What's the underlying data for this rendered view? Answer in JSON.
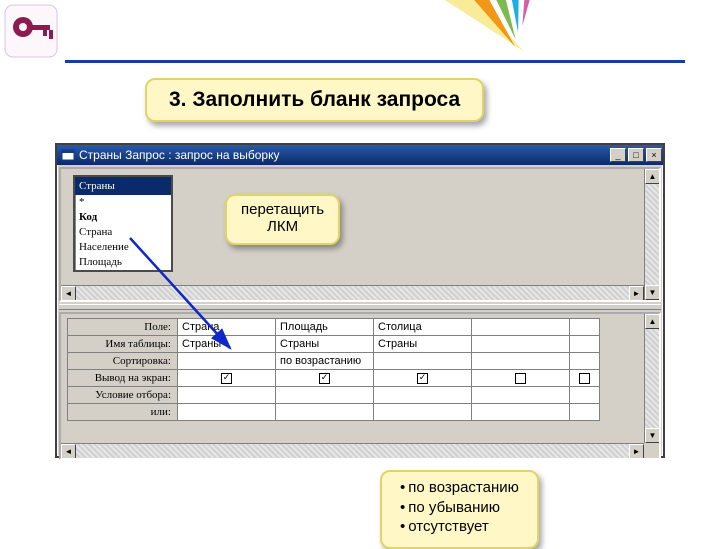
{
  "callouts": {
    "title": "3. Заполнить бланк запроса",
    "drag_line1": "перетащить",
    "drag_line2": "ЛКМ",
    "sort_opt1": "по возрастанию",
    "sort_opt2": "по убыванию",
    "sort_opt3": "отсутствует"
  },
  "window": {
    "title": "Страны Запрос : запрос на выборку",
    "min_glyph": "_",
    "max_glyph": "□",
    "close_glyph": "×",
    "field_list": {
      "table_name": "Страны",
      "items": {
        "star": "*",
        "kod": "Код",
        "strana": "Страна",
        "naselenie": "Население",
        "ploshchad": "Площадь"
      }
    },
    "scroll": {
      "left": "◄",
      "right": "►",
      "up": "▲",
      "down": "▼"
    }
  },
  "grid": {
    "row_labels": {
      "field": "Поле:",
      "table": "Имя таблицы:",
      "sort": "Сортировка:",
      "show": "Вывод на экран:",
      "criteria": "Условие отбора:",
      "or": "или:"
    },
    "cols": [
      {
        "field": "Страна",
        "table": "Страны",
        "sort": "",
        "show": true
      },
      {
        "field": "Площадь",
        "table": "Страны",
        "sort": "по возрастанию",
        "show": true
      },
      {
        "field": "Столица",
        "table": "Страны",
        "sort": "",
        "show": true
      },
      {
        "field": "",
        "table": "",
        "sort": "",
        "show": false
      },
      {
        "field": "",
        "table": "",
        "sort": "",
        "show": false
      }
    ]
  }
}
